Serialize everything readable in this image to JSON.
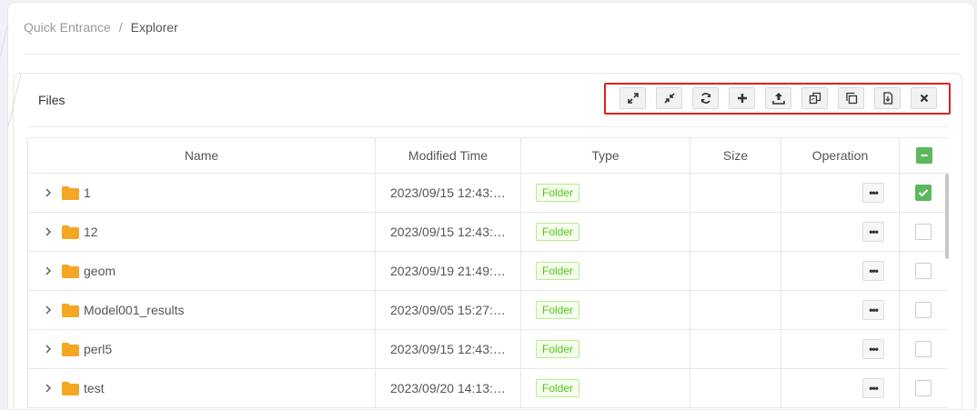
{
  "breadcrumb": {
    "items": [
      "Quick Entrance",
      "Explorer"
    ],
    "separator": "/"
  },
  "panel": {
    "title": "Files"
  },
  "toolbar": {
    "buttons": [
      {
        "name": "expand-all",
        "icon": "expand-icon"
      },
      {
        "name": "collapse-all",
        "icon": "compress-icon"
      },
      {
        "name": "refresh",
        "icon": "refresh-icon"
      },
      {
        "name": "add",
        "icon": "plus-icon"
      },
      {
        "name": "upload",
        "icon": "upload-icon"
      },
      {
        "name": "copy",
        "icon": "copy-icon"
      },
      {
        "name": "duplicate",
        "icon": "duplicate-icon"
      },
      {
        "name": "download",
        "icon": "file-download-icon"
      },
      {
        "name": "delete",
        "icon": "close-icon"
      }
    ]
  },
  "table": {
    "columns": {
      "name": "Name",
      "modified": "Modified Time",
      "type": "Type",
      "size": "Size",
      "operation": "Operation"
    },
    "rows": [
      {
        "name": "1",
        "modified": "2023/09/15 12:43:…",
        "type": "Folder",
        "size": "",
        "checked": true
      },
      {
        "name": "12",
        "modified": "2023/09/15 12:43:…",
        "type": "Folder",
        "size": "",
        "checked": false
      },
      {
        "name": "geom",
        "modified": "2023/09/19 21:49:…",
        "type": "Folder",
        "size": "",
        "checked": false
      },
      {
        "name": "Model001_results",
        "modified": "2023/09/05 15:27:…",
        "type": "Folder",
        "size": "",
        "checked": false
      },
      {
        "name": "perl5",
        "modified": "2023/09/15 12:43:…",
        "type": "Folder",
        "size": "",
        "checked": false
      },
      {
        "name": "test",
        "modified": "2023/09/20 14:13:…",
        "type": "Folder",
        "size": "",
        "checked": false
      }
    ],
    "more_label": "•••"
  },
  "colors": {
    "accent_green": "#5cb85c",
    "folder_orange": "#f5a623",
    "highlight_red": "#e02020",
    "tag_green": "#52c41a"
  }
}
